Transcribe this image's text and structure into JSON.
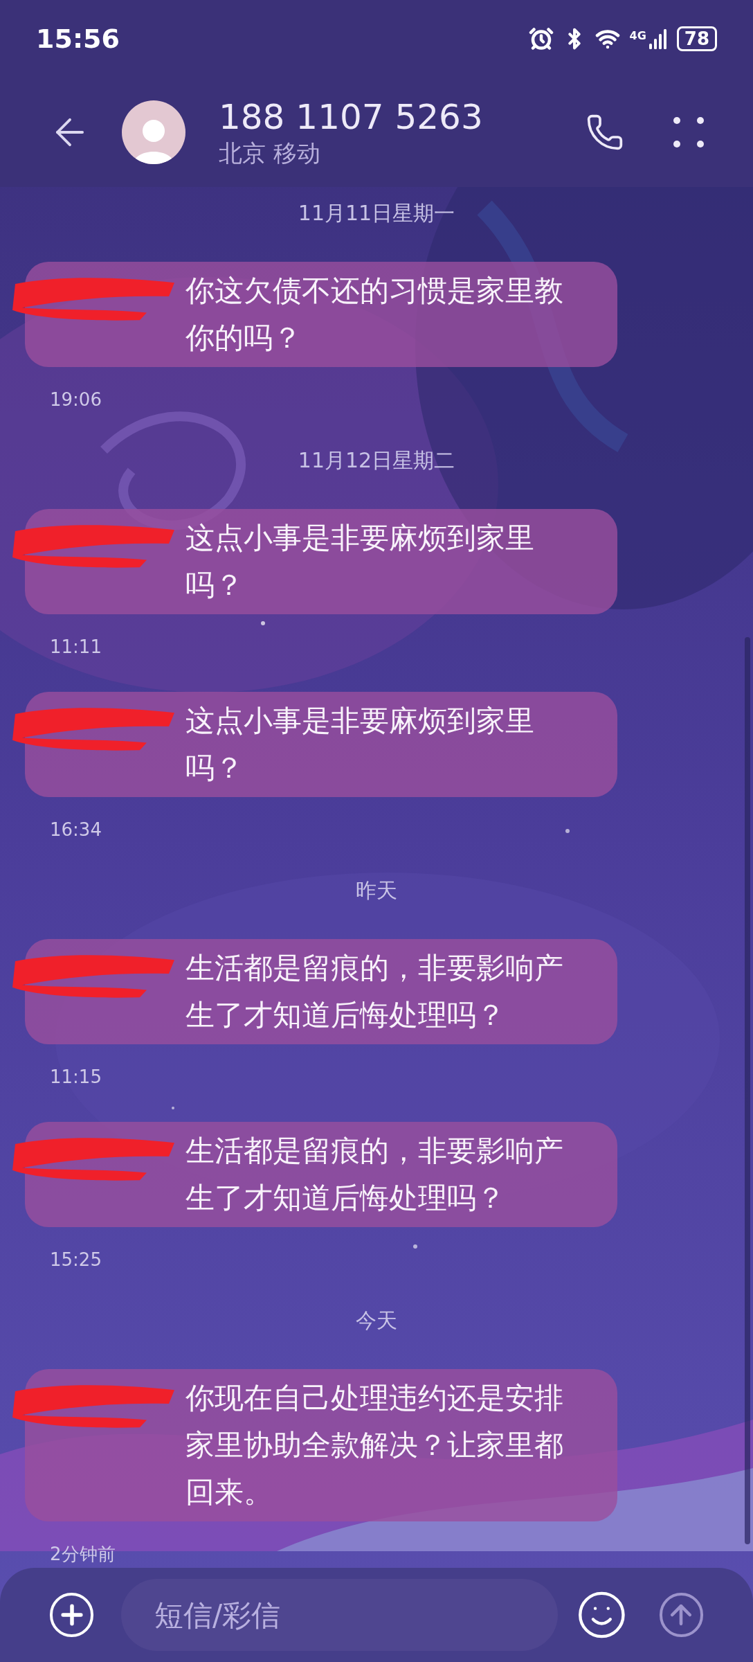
{
  "status_bar": {
    "time": "15:56",
    "network": "4G",
    "battery": "78"
  },
  "header": {
    "contact": "188 1107 5263",
    "location": "北京 移动"
  },
  "thread": [
    {
      "kind": "date",
      "text": "11月11日星期一"
    },
    {
      "kind": "message",
      "text": "你这欠债不还的习惯是家里教你的吗？",
      "time": "19:06"
    },
    {
      "kind": "date",
      "text": "11月12日星期二"
    },
    {
      "kind": "message",
      "text": "这点小事是非要麻烦到家里吗？",
      "time": "11:11"
    },
    {
      "kind": "message",
      "text": "这点小事是非要麻烦到家里吗？",
      "time": "16:34"
    },
    {
      "kind": "date",
      "text": "昨天"
    },
    {
      "kind": "message",
      "text": "生活都是留痕的，非要影响产生了才知道后悔处理吗？",
      "time": "11:15"
    },
    {
      "kind": "message",
      "text": "生活都是留痕的，非要影响产生了才知道后悔处理吗？",
      "time": "15:25"
    },
    {
      "kind": "date",
      "text": "今天"
    },
    {
      "kind": "message",
      "text": "你现在自己处理违约还是安排家里协助全款解决？让家里都回来。",
      "time": "2分钟前"
    }
  ],
  "composer": {
    "placeholder": "短信/彩信"
  }
}
